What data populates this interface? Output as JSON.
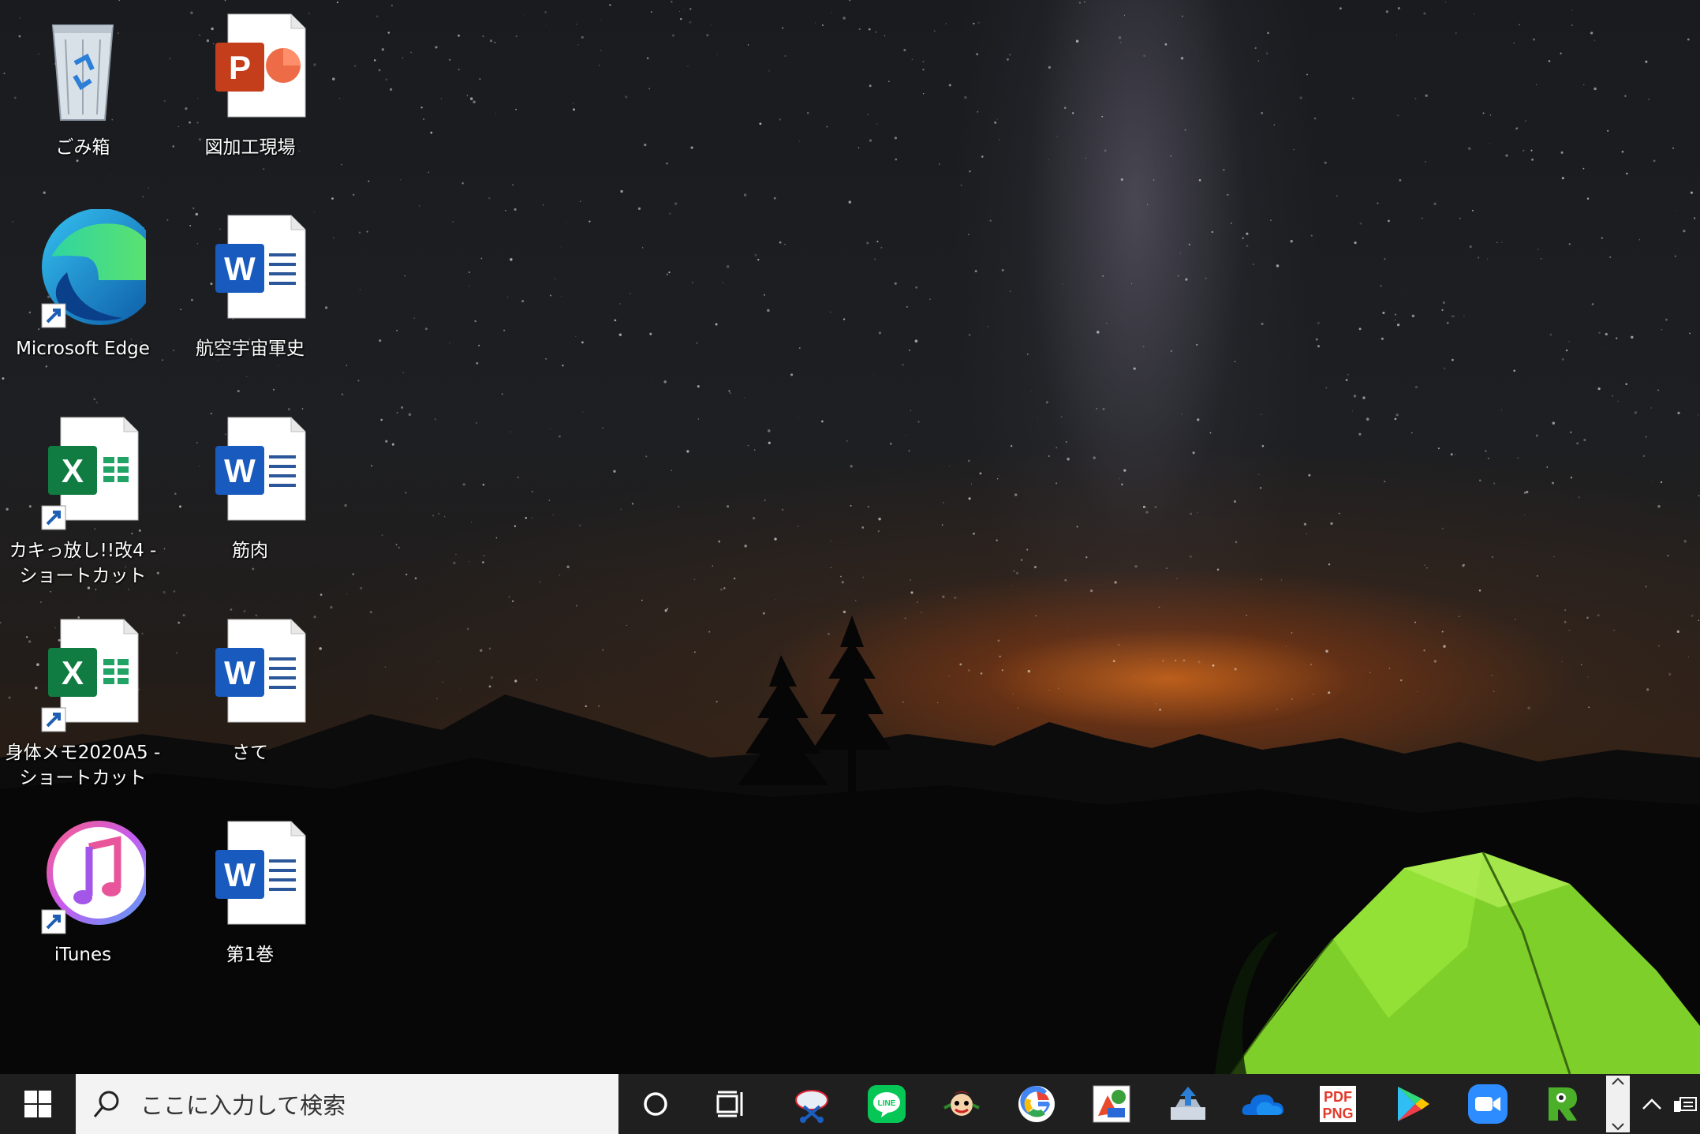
{
  "desktop": {
    "icons": [
      {
        "label": "ごみ箱",
        "icon": "recycle-bin-icon",
        "shortcut": false
      },
      {
        "label": "図加工現場",
        "icon": "powerpoint-file-icon",
        "shortcut": false
      },
      {
        "label": "Microsoft Edge",
        "icon": "edge-icon",
        "shortcut": true
      },
      {
        "label": "航空宇宙軍史",
        "icon": "word-file-icon",
        "shortcut": false
      },
      {
        "label": "カキっ放し!!改4 - ショートカット",
        "icon": "excel-file-icon",
        "shortcut": true
      },
      {
        "label": "筋肉",
        "icon": "word-file-icon",
        "shortcut": false
      },
      {
        "label": "身体メモ2020A5 - ショートカット",
        "icon": "excel-file-icon",
        "shortcut": true
      },
      {
        "label": "さて",
        "icon": "word-file-icon",
        "shortcut": false
      },
      {
        "label": "iTunes",
        "icon": "itunes-icon",
        "shortcut": true
      },
      {
        "label": "第1巻",
        "icon": "word-file-icon",
        "shortcut": false
      }
    ]
  },
  "taskbar": {
    "search_placeholder": "ここに入力して検索",
    "pdf_icon_text_1": "PDF",
    "pdf_icon_text_2": "PNG",
    "line_icon_text": "LINE",
    "apps": [
      "cortana-icon",
      "task-view-icon",
      "snipping-tool-icon",
      "line-icon",
      "character-app-icon",
      "google-chrome-icon",
      "paint-app-icon",
      "upload-app-icon",
      "onedrive-icon",
      "pdf-png-converter-icon",
      "google-play-icon",
      "zoom-icon",
      "green-r-app-icon"
    ],
    "colors": {
      "taskbar_bg": "#1f1f1f",
      "search_bg": "#f3f3f3"
    }
  }
}
